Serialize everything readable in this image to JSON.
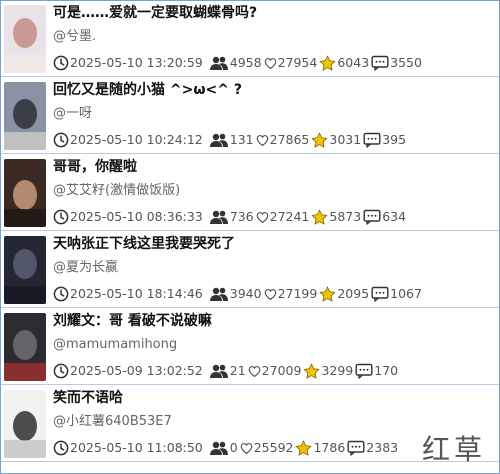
{
  "items": [
    {
      "title": "可是……爱就一定要取蝴蝶骨吗?",
      "author": "@兮墨.",
      "time": "2025-05-10 13:20:59",
      "viewers": "4958",
      "likes": "27954",
      "stars": "6043",
      "comments": "3550",
      "thumb_colors": [
        "#e9e2e6",
        "#c48b86",
        "#f2ece8"
      ]
    },
    {
      "title": "回忆又是随的小猫 ^>ω<^ ?",
      "author": "@一呀",
      "time": "2025-05-10 10:24:12",
      "viewers": "131",
      "likes": "27865",
      "stars": "3031",
      "comments": "395",
      "thumb_colors": [
        "#8a93a3",
        "#2b2f3a",
        "#d9d3cc"
      ]
    },
    {
      "title": "哥哥，你醒啦",
      "author": "@艾艾籽(激情做饭版)",
      "time": "2025-05-10 08:36:33",
      "viewers": "736",
      "likes": "27241",
      "stars": "5873",
      "comments": "634",
      "thumb_colors": [
        "#3b2a22",
        "#c99a7c",
        "#1b1411"
      ]
    },
    {
      "title": "天呐张正下线这里我要哭死了",
      "author": "@夏为长嬴",
      "time": "2025-05-10 18:14:46",
      "viewers": "3940",
      "likes": "27199",
      "stars": "2095",
      "comments": "1067",
      "thumb_colors": [
        "#232633",
        "#5a5f73",
        "#141520"
      ]
    },
    {
      "title": "刘耀文：哥 看破不说破嘛",
      "author": "@mamumamihong",
      "time": "2025-05-09 13:02:52",
      "viewers": "21",
      "likes": "27009",
      "stars": "3299",
      "comments": "170",
      "thumb_colors": [
        "#2c2c30",
        "#6d6d72",
        "#b03030"
      ]
    },
    {
      "title": "笑而不语哈",
      "author": "@小红薯640B53E7",
      "time": "2025-05-10 11:08:50",
      "viewers": "0",
      "likes": "25592",
      "stars": "1786",
      "comments": "2383",
      "thumb_colors": [
        "#f2f2f2",
        "#303030",
        "#bdbdbd"
      ]
    }
  ],
  "watermark": "红草",
  "colors": {
    "border": "#7a9fd6",
    "divider": "#b9c9e6",
    "star": "#f2c200",
    "icon": "#333333"
  },
  "icons": {
    "time": "clock-icon",
    "viewers": "people-icon",
    "likes": "heart-icon",
    "stars": "star-icon",
    "comments": "comment-icon"
  }
}
